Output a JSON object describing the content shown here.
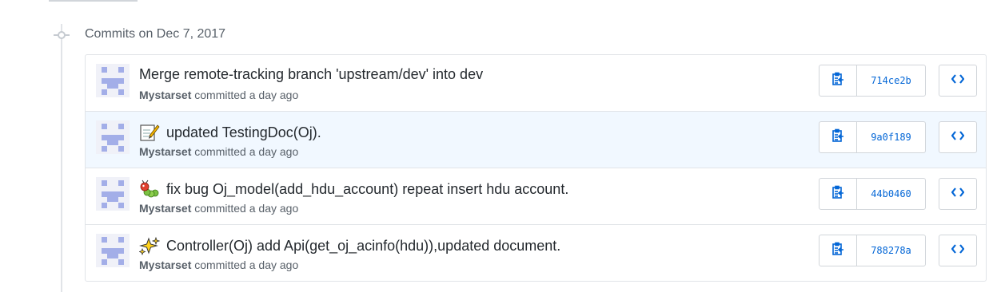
{
  "group": {
    "title": "Commits on Dec 7, 2017"
  },
  "colors": {
    "link": "#0366d6",
    "muted": "#586069",
    "border": "#e1e4e8",
    "highlight_row": "#f1f8ff"
  },
  "commits": [
    {
      "message": "Merge remote-tracking branch 'upstream/dev' into dev",
      "emoji": "",
      "author": "Mystarset",
      "action": "committed a day ago",
      "sha": "714ce2b"
    },
    {
      "message": "updated TestingDoc(Oj).",
      "emoji": "memo-icon",
      "author": "Mystarset",
      "action": "committed a day ago",
      "sha": "9a0f189"
    },
    {
      "message": "fix bug Oj_model(add_hdu_account) repeat insert hdu account.",
      "emoji": "bug-icon",
      "author": "Mystarset",
      "action": "committed a day ago",
      "sha": "44b0460"
    },
    {
      "message": "Controller(Oj) add Api(get_oj_acinfo(hdu)),updated document.",
      "emoji": "sparkles-icon",
      "author": "Mystarset",
      "action": "committed a day ago",
      "sha": "788278a"
    }
  ],
  "icons": {
    "copy": "clippy-icon",
    "browse": "code-icon",
    "timeline": "commit-node-icon"
  }
}
